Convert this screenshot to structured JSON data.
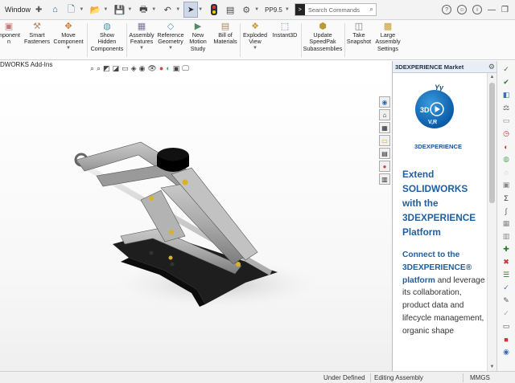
{
  "menubar": {
    "window_menu": "Window",
    "pp_label": "PP9.5",
    "search_placeholder": "Search Commands"
  },
  "ribbon": {
    "buttons": [
      {
        "label": "mponent\nn",
        "icon": "component-icon"
      },
      {
        "label": "Smart\nFasteners",
        "icon": "smart-fasteners-icon"
      },
      {
        "label": "Move\nComponent",
        "icon": "move-component-icon"
      },
      {
        "label": "Show\nHidden\nComponents",
        "icon": "show-hidden-icon"
      },
      {
        "label": "Assembly\nFeatures",
        "icon": "assembly-features-icon"
      },
      {
        "label": "Reference\nGeometry",
        "icon": "reference-geometry-icon"
      },
      {
        "label": "New\nMotion\nStudy",
        "icon": "motion-study-icon"
      },
      {
        "label": "Bill of\nMaterials",
        "icon": "bom-icon"
      },
      {
        "label": "Exploded\nView",
        "icon": "exploded-view-icon"
      },
      {
        "label": "Instant3D",
        "icon": "instant3d-icon"
      },
      {
        "label": "Update\nSpeedPak\nSubassemblies",
        "icon": "speedpak-icon"
      },
      {
        "label": "Take\nSnapshot",
        "icon": "snapshot-icon"
      },
      {
        "label": "Large\nAssembly\nSettings",
        "icon": "large-assembly-icon"
      }
    ]
  },
  "addins_tab": "DWORKS Add-Ins",
  "taskpane": {
    "header": "3DEXPERIENCE Market",
    "logo_text": "3D",
    "logo_sub": "V,R",
    "logo_cap": "Yy",
    "brand": "3DEXPERIENCE",
    "headline": "Extend SOLIDWORKS with the 3DEXPERIENCE Platform",
    "body_bold": "Connect to the 3DEXPERIENCE® platform",
    "body_rest": " and leverage its collaboration, product data and lifecycle management, organic shape"
  },
  "statusbar": {
    "state": "Under Defined",
    "mode": "Editing Assembly",
    "units": "MMGS"
  }
}
